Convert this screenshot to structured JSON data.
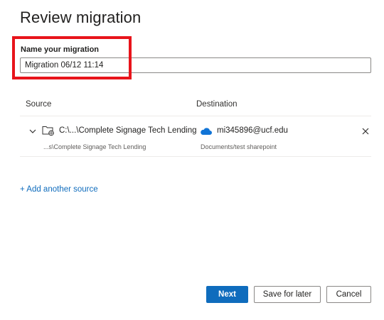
{
  "page": {
    "title": "Review migration"
  },
  "name_field": {
    "label": "Name your migration",
    "value": "Migration 06/12 11:14"
  },
  "table": {
    "headers": {
      "source": "Source",
      "destination": "Destination"
    },
    "rows": [
      {
        "source_path": "C:\\...\\Complete Signage Tech Lending",
        "source_sub": "...s\\Complete Signage Tech Lending",
        "destination_account": "mi345896@ucf.edu",
        "destination_sub": "Documents/test sharepoint"
      }
    ]
  },
  "add_source_label": "+ Add another source",
  "buttons": {
    "next": "Next",
    "save_for_later": "Save for later",
    "cancel": "Cancel"
  },
  "colors": {
    "accent": "#0f6cbd",
    "highlight": "#e8141b"
  },
  "icons": {
    "chevron": "chevron-down-icon",
    "folder": "folder-network-icon",
    "cloud": "onedrive-cloud-icon",
    "remove": "close-icon"
  }
}
